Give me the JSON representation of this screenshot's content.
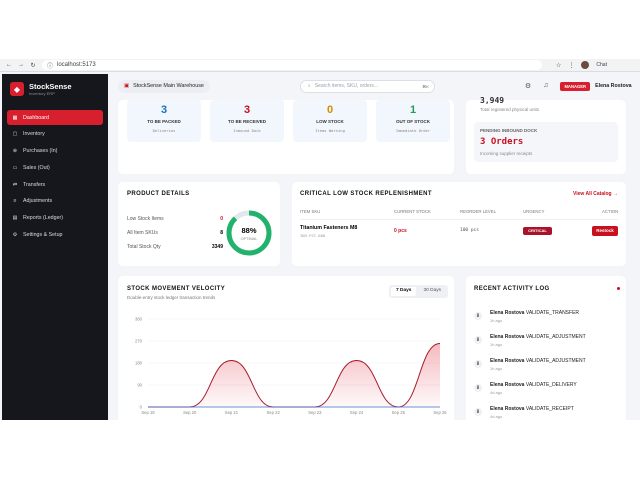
{
  "browser": {
    "url": "localhost:5173",
    "chat_label": "Chat"
  },
  "sidebar": {
    "app_name": "StockSense",
    "app_sub": "Inventory ERP",
    "items": [
      {
        "label": "Dashboard",
        "icon": "grid-icon"
      },
      {
        "label": "Inventory",
        "icon": "box-icon"
      },
      {
        "label": "Purchases (In)",
        "icon": "cart-icon"
      },
      {
        "label": "Sales (Out)",
        "icon": "truck-icon"
      },
      {
        "label": "Transfers",
        "icon": "arrows-icon"
      },
      {
        "label": "Adjustments",
        "icon": "sliders-icon"
      },
      {
        "label": "Reports (Ledger)",
        "icon": "report-icon"
      },
      {
        "label": "Settings & Setup",
        "icon": "gear-icon"
      }
    ]
  },
  "header": {
    "warehouse": "StockSense Main Warehouse",
    "search_placeholder": "Search items, SKU, orders...",
    "search_shortcut": "⌘K",
    "role_badge": "MANAGER",
    "user_name": "Elena Rostova"
  },
  "stats": [
    {
      "value": "3",
      "label": "TO BE PACKED",
      "sub": "Deliveries",
      "color": "#1b6fb8"
    },
    {
      "value": "3",
      "label": "TO BE RECEIVED",
      "sub": "Inbound Dock",
      "color": "#c7111f"
    },
    {
      "value": "0",
      "label": "LOW STOCK",
      "sub": "Items Warning",
      "color": "#d98a00"
    },
    {
      "value": "1",
      "label": "OUT OF STOCK",
      "sub": "Immediate Order",
      "color": "#1f9d55"
    }
  ],
  "inbound": {
    "top_value_partial": "3,949",
    "top_sub": "Total registered physical units",
    "label": "PENDING INBOUND DOCK",
    "value": "3 Orders",
    "sub": "Incoming supplier receipts"
  },
  "product_details": {
    "title": "PRODUCT DETAILS",
    "rows": [
      {
        "label": "Low Stock Items",
        "value": "0",
        "color": "#c7111f"
      },
      {
        "label": "All Item SKUs",
        "value": "8",
        "color": "#222222"
      },
      {
        "label": "Total Stock Qty",
        "value": "3349",
        "color": "#222222"
      }
    ],
    "gauge_value": "88%",
    "gauge_label": "OPTIMAL",
    "gauge_fraction": 0.88
  },
  "replenish": {
    "title": "CRITICAL LOW STOCK REPLENISHMENT",
    "link": "View All Catalog →",
    "columns": [
      "ITEM SKU",
      "CURRENT STOCK",
      "REORDER LEVEL",
      "URGENCY",
      "ACTION"
    ],
    "row": {
      "name": "Titanium Fasteners M8",
      "sku": "INV-FST-008",
      "current": "0 pcs",
      "reorder": "100 pcs",
      "urgency": "CRITICAL",
      "action": "Restock"
    }
  },
  "velocity": {
    "title": "STOCK MOVEMENT VELOCITY",
    "subtitle": "Double-entry stock ledger transaction trends",
    "tabs": [
      "7 Days",
      "30 Days"
    ]
  },
  "chart_data": {
    "type": "line",
    "x": [
      "Sep 19",
      "Sep 20",
      "Sep 21",
      "Sep 22",
      "Sep 23",
      "Sep 24",
      "Sep 25",
      "Sep 26"
    ],
    "series": [
      {
        "values": [
          0,
          0,
          190,
          0,
          0,
          190,
          0,
          260
        ],
        "color": "#a61d2c"
      },
      {
        "values": [
          0,
          0,
          0,
          0,
          0,
          0,
          0,
          0
        ],
        "color": "#3b6fd1"
      }
    ],
    "yticks": [
      "0",
      "90",
      "180",
      "270",
      "360"
    ],
    "ylim": [
      0,
      360
    ],
    "grid": true
  },
  "activity": {
    "title": "RECENT ACTIVITY LOG",
    "items": [
      {
        "user": "Elena Rostova",
        "action": "VALIDATE_TRANSFER",
        "ago": "1h ago"
      },
      {
        "user": "Elena Rostova",
        "action": "VALIDATE_ADJUSTMENT",
        "ago": "1h ago"
      },
      {
        "user": "Elena Rostova",
        "action": "VALIDATE_ADJUSTMENT",
        "ago": "1h ago"
      },
      {
        "user": "Elena Rostova",
        "action": "VALIDATE_DELIVERY",
        "ago": "4d ago"
      },
      {
        "user": "Elena Rostova",
        "action": "VALIDATE_RECEIPT",
        "ago": "4d ago"
      }
    ]
  }
}
